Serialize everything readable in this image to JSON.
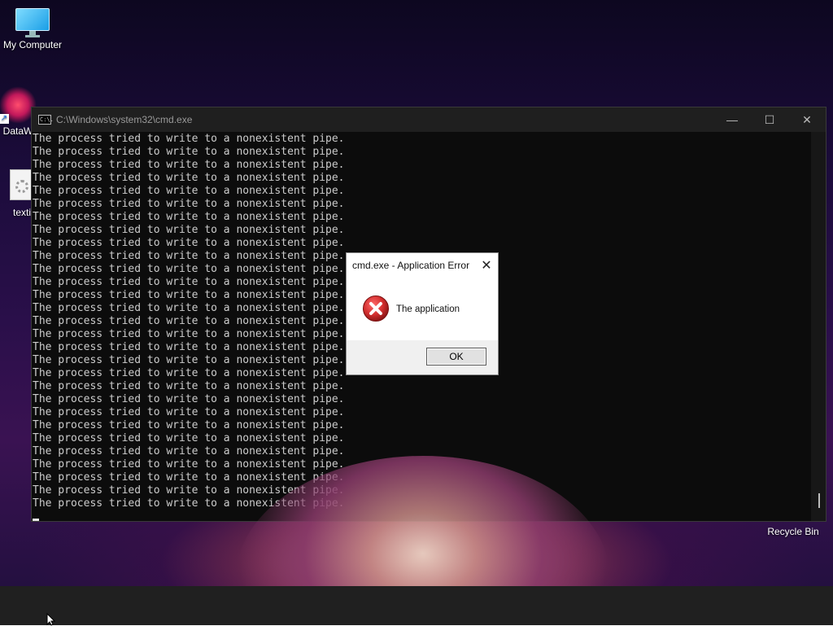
{
  "desktop": {
    "icons": [
      {
        "label": "My Computer",
        "icon": "monitor-icon"
      },
      {
        "label": "DataW",
        "icon": "datawrapper-app-icon"
      },
      {
        "label": "texti",
        "icon": "text-file-icon"
      },
      {
        "label": "Recycle Bin",
        "icon": "recycle-bin-icon"
      }
    ]
  },
  "cmd_window": {
    "title": "C:\\Windows\\system32\\cmd.exe",
    "icon": "cmd-icon",
    "icon_text": "C:\\.",
    "controls": {
      "minimize": "—",
      "maximize": "☐",
      "close": "✕"
    },
    "output_line": "The process tried to write to a nonexistent pipe.",
    "line_count": 29
  },
  "error_dialog": {
    "title": "cmd.exe - Application Error",
    "close": "✕",
    "message": "The application",
    "icon": "error-icon",
    "ok_label": "OK"
  },
  "colors": {
    "terminal_bg": "#0c0c0c",
    "terminal_text": "#cccccc",
    "titlebar": "#1f1f1f",
    "error_red": "#d32f2f",
    "taskbar": "#202020"
  }
}
